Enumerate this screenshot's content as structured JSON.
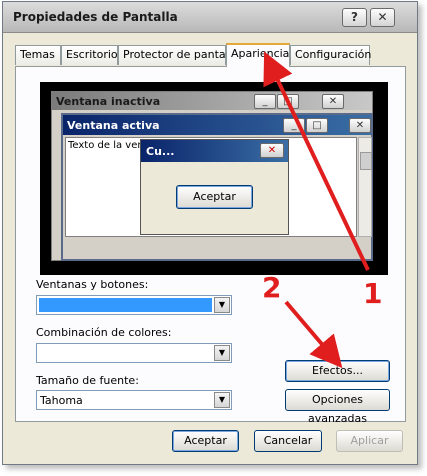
{
  "window": {
    "title": "Propiedades de Pantalla",
    "help_btn": "?",
    "close_btn": "✕"
  },
  "tabs": [
    "Temas",
    "Escritorio",
    "Protector de pantalla",
    "Apariencia",
    "Configuración"
  ],
  "active_tab": "Apariencia",
  "preview": {
    "inactive_title": "Ventana inactiva",
    "active_title": "Ventana activa",
    "window_text": "Texto de la vent",
    "msgbox_title": "Cu...",
    "msgbox_button": "Aceptar",
    "min_glyph": "_",
    "max_glyph": "□",
    "close_glyph": "✕"
  },
  "fields": {
    "windows_buttons_label": "Ventanas y botones:",
    "windows_buttons_value": "",
    "color_scheme_label": "Combinación de colores:",
    "color_scheme_value": "",
    "font_size_label": "Tamaño de fuente:",
    "font_size_value": "Tahoma"
  },
  "side_buttons": {
    "effects": "Efectos...",
    "advanced": "Opciones avanzadas"
  },
  "footer": {
    "ok": "Aceptar",
    "cancel": "Cancelar",
    "apply": "Aplicar"
  },
  "annotations": {
    "one": "1",
    "two": "2"
  },
  "colors": {
    "accent": "#e01e1e",
    "selection_blue": "#3399ff",
    "active_title_start": "#0a246a"
  }
}
